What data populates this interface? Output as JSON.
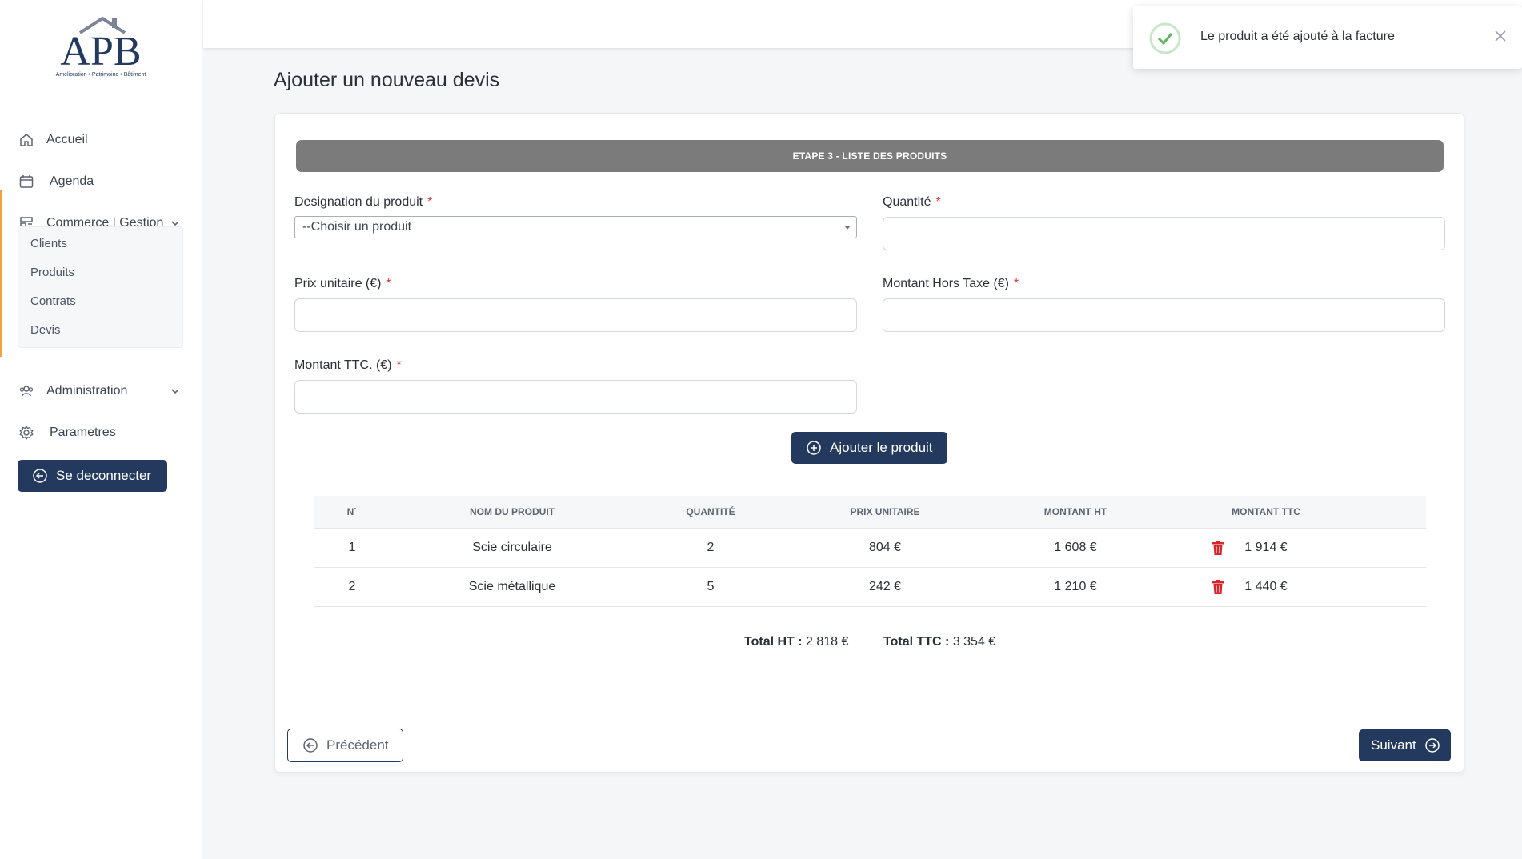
{
  "brand": {
    "logo_text": "APB",
    "tagline": "Amélioration • Patrimoine • Bâtiment"
  },
  "sidebar": {
    "items": [
      {
        "label": "Accueil",
        "icon": "home-icon"
      },
      {
        "label": "Agenda",
        "icon": "calendar-icon"
      },
      {
        "label": "Commerce | Gestion",
        "icon": "store-icon"
      },
      {
        "label": "Administration",
        "icon": "users-icon"
      },
      {
        "label": "Parametres",
        "icon": "gear-icon"
      }
    ],
    "submenu": [
      {
        "label": "Clients"
      },
      {
        "label": "Produits"
      },
      {
        "label": "Contrats"
      },
      {
        "label": "Devis"
      }
    ],
    "logout_label": "Se deconnecter"
  },
  "toast": {
    "message": "Le produit a été ajouté à la facture"
  },
  "page": {
    "title": "Ajouter un nouveau devis",
    "step_title": "ETAPE 3 - LISTE DES PRODUITS"
  },
  "form": {
    "designation_label": "Designation du produit",
    "designation_value": "--Choisir un produit",
    "quantite_label": "Quantité",
    "prix_label": "Prix unitaire (€)",
    "montant_ht_label": "Montant Hors Taxe (€)",
    "montant_ttc_label": "Montant TTC. (€)",
    "required_mark": "*",
    "add_button": "Ajouter le produit"
  },
  "table": {
    "headers": [
      "N`",
      "NOM DU PRODUIT",
      "QUANTITÉ",
      "PRIX UNITAIRE",
      "MONTANT HT",
      "MONTANT TTC"
    ],
    "rows": [
      {
        "n": "1",
        "nom": "Scie circulaire",
        "quantite": "2",
        "prix": "804 €",
        "ht": "1 608 €",
        "ttc": "1 914 €"
      },
      {
        "n": "2",
        "nom": "Scie métallique",
        "quantite": "5",
        "prix": "242 €",
        "ht": "1 210 €",
        "ttc": "1 440 €"
      }
    ]
  },
  "totals": {
    "ht_label": "Total HT :",
    "ht_value": "2 818 €",
    "ttc_label": "Total TTC :",
    "ttc_value": "3 354 €"
  },
  "footer": {
    "prev_label": "Précédent",
    "next_label": "Suivant"
  },
  "colors": {
    "primary": "#233a5e",
    "accent": "#f0a33a",
    "step_header": "#7b7b7b",
    "danger": "#d9262d",
    "success": "#5cb85c"
  }
}
